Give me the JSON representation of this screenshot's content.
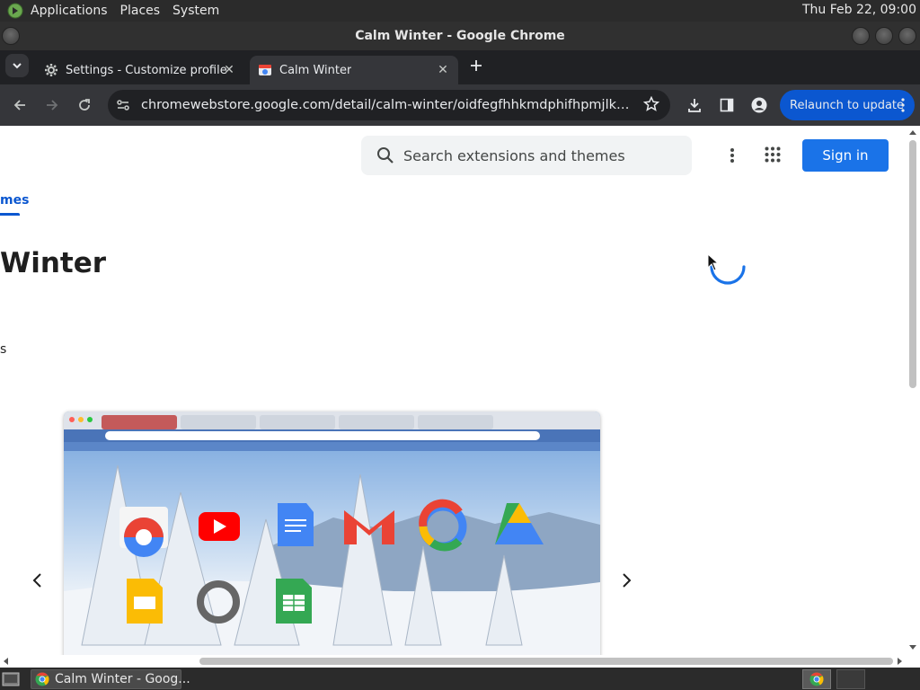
{
  "top_panel": {
    "menus": [
      "Applications",
      "Places",
      "System"
    ],
    "clock": "Thu Feb 22, 09:00"
  },
  "window": {
    "title": "Calm Winter - Google Chrome"
  },
  "tabs": [
    {
      "label": "Settings - Customize profile",
      "icon": "gear-icon",
      "active": false
    },
    {
      "label": "Calm Winter",
      "icon": "theme-favicon",
      "active": true
    }
  ],
  "toolbar": {
    "url": "chromewebstore.google.com/detail/calm-winter/oidfegfhhkmdphifhpmjlkbhokhknmb...",
    "relaunch_label": "Relaunch to update"
  },
  "page": {
    "search_placeholder": "Search extensions and themes",
    "sign_in_label": "Sign in",
    "nav_tab_fragment": "mes",
    "item_title_fragment": "Winter",
    "item_sub_fragment": "s"
  },
  "taskbar": {
    "window_button_label": "Calm Winter - Goog..."
  },
  "colors": {
    "accent_blue": "#1a73e8",
    "relaunch_blue": "#0b57d0",
    "chrome_dark": "#35363a",
    "tabstrip_dark": "#202124"
  }
}
